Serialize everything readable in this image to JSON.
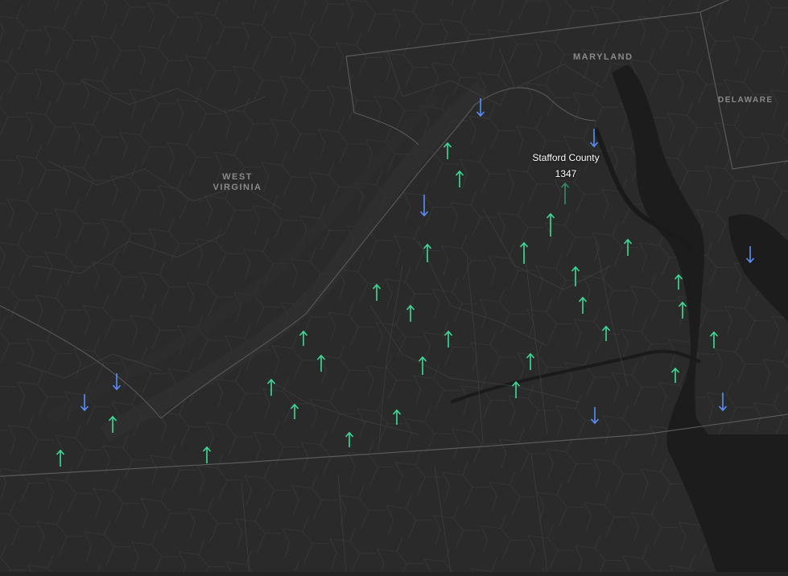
{
  "map": {
    "labels": {
      "maryland": "MARYLAND",
      "delaware": "DELAWARE",
      "west_virginia_1": "WEST",
      "west_virginia_2": "VIRGINIA"
    },
    "tooltip": {
      "name": "Stafford County",
      "value": "1347"
    },
    "colors": {
      "background": "#242424",
      "land": "#2a2a2a",
      "water": "#161616",
      "border_county": "#3c3c3c",
      "border_state": "#5a5a5a",
      "increase": "#3ddc97",
      "decrease": "#5b8ff9"
    },
    "legend_meaning": {
      "up": "increase",
      "down": "decrease"
    }
  }
}
